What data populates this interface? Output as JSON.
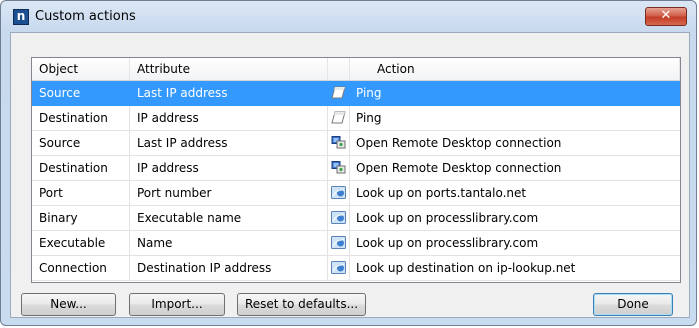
{
  "window": {
    "title": "Custom actions",
    "app_icon_letter": "n",
    "close_glyph": "✕"
  },
  "table": {
    "headers": [
      "Object",
      "Attribute",
      "",
      "Action"
    ],
    "rows": [
      {
        "object": "Source",
        "attribute": "Last IP address",
        "icon": "eraser-icon",
        "action": "Ping",
        "selected": true
      },
      {
        "object": "Destination",
        "attribute": "IP address",
        "icon": "eraser-icon",
        "action": "Ping",
        "selected": false
      },
      {
        "object": "Source",
        "attribute": "Last IP address",
        "icon": "remote-desktop-icon",
        "action": "Open Remote Desktop connection",
        "selected": false
      },
      {
        "object": "Destination",
        "attribute": "IP address",
        "icon": "remote-desktop-icon",
        "action": "Open Remote Desktop connection",
        "selected": false
      },
      {
        "object": "Port",
        "attribute": "Port number",
        "icon": "web-lookup-icon",
        "action": "Look up on ports.tantalo.net",
        "selected": false
      },
      {
        "object": "Binary",
        "attribute": "Executable name",
        "icon": "web-lookup-icon",
        "action": "Look up on processlibrary.com",
        "selected": false
      },
      {
        "object": "Executable",
        "attribute": "Name",
        "icon": "web-lookup-icon",
        "action": "Look up on processlibrary.com",
        "selected": false
      },
      {
        "object": "Connection",
        "attribute": "Destination IP address",
        "icon": "web-lookup-icon",
        "action": "Look up destination on ip-lookup.net",
        "selected": false
      }
    ]
  },
  "buttons": {
    "new": "New...",
    "import": "Import...",
    "reset": "Reset to defaults...",
    "done": "Done"
  },
  "colors": {
    "selection": "#3399ff",
    "close_button": "#c94a32",
    "app_icon": "#1d4f93"
  }
}
